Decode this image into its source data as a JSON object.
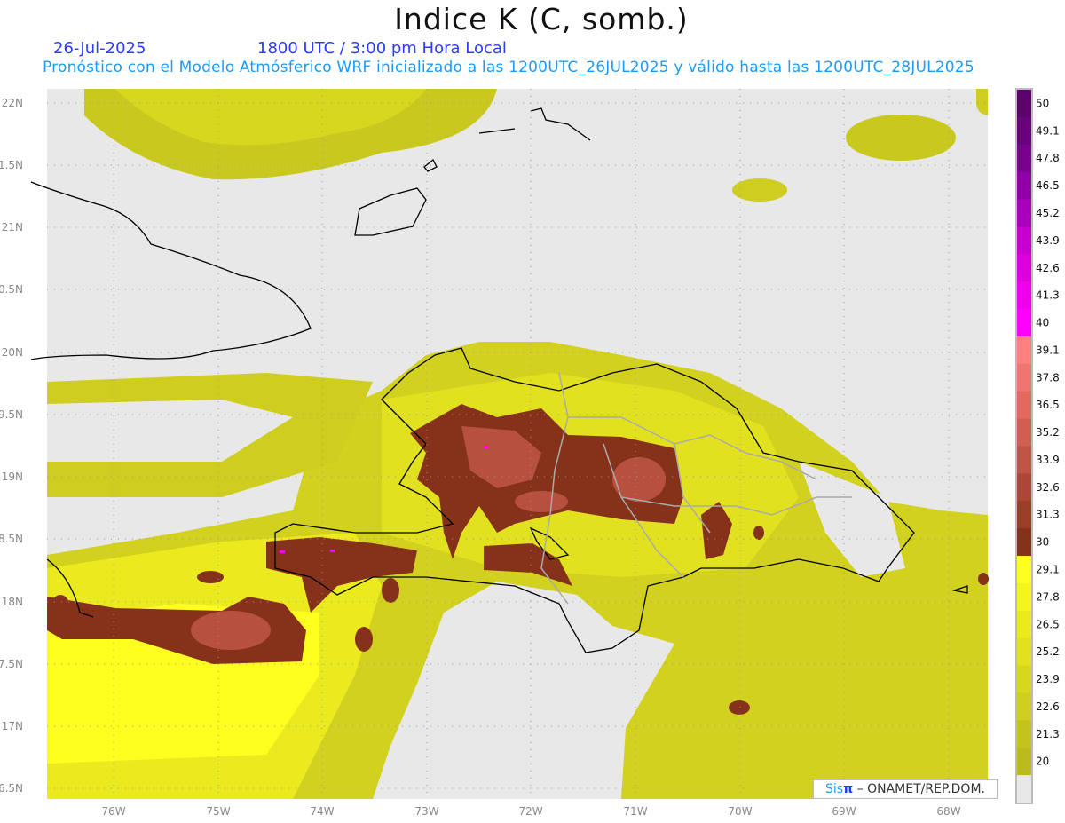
{
  "header": {
    "title": "Indice K (C, somb.)",
    "date": "26-Jul-2025",
    "time": "1800 UTC / 3:00 pm Hora Local",
    "subtitle": "Pronóstico con el Modelo Atmósferico WRF inicializado a las 1200UTC_26JUL2025 y válido hasta las  1200UTC_28JUL2025"
  },
  "axes": {
    "lat_labels": [
      "22N",
      "1.5N",
      "21N",
      "0.5N",
      "20N",
      "9.5N",
      "19N",
      "8.5N",
      "18N",
      "7.5N",
      "17N",
      "6.5N"
    ],
    "lon_labels": [
      "76W",
      "75W",
      "74W",
      "73W",
      "72W",
      "71W",
      "70W",
      "69W",
      "68W"
    ]
  },
  "colorbar": {
    "labels": [
      "50",
      "49.1",
      "47.8",
      "46.5",
      "45.2",
      "43.9",
      "42.6",
      "41.3",
      "40",
      "39.1",
      "37.8",
      "36.5",
      "35.2",
      "33.9",
      "32.6",
      "31.3",
      "30",
      "29.1",
      "27.8",
      "26.5",
      "25.2",
      "23.9",
      "22.6",
      "21.3",
      "20"
    ],
    "colors": [
      "#5e006e",
      "#6a007e",
      "#7a008e",
      "#8f00a6",
      "#a800bb",
      "#c600cf",
      "#dc00dc",
      "#ee00ee",
      "#ff00ff",
      "#ff8080",
      "#ee7570",
      "#e06a60",
      "#cf5f50",
      "#bf5444",
      "#ad4636",
      "#9c3d28",
      "#86321a",
      "#ffff1f",
      "#f5f41f",
      "#ebea1f",
      "#e2e11f",
      "#d8d71f",
      "#cfcd1f",
      "#c4c31e",
      "#bcbb1e",
      "#e8e8e8"
    ]
  },
  "credit": {
    "brand_a": "Sis",
    "brand_b": "π",
    "text": "– ONAMET/REP.DOM."
  }
}
